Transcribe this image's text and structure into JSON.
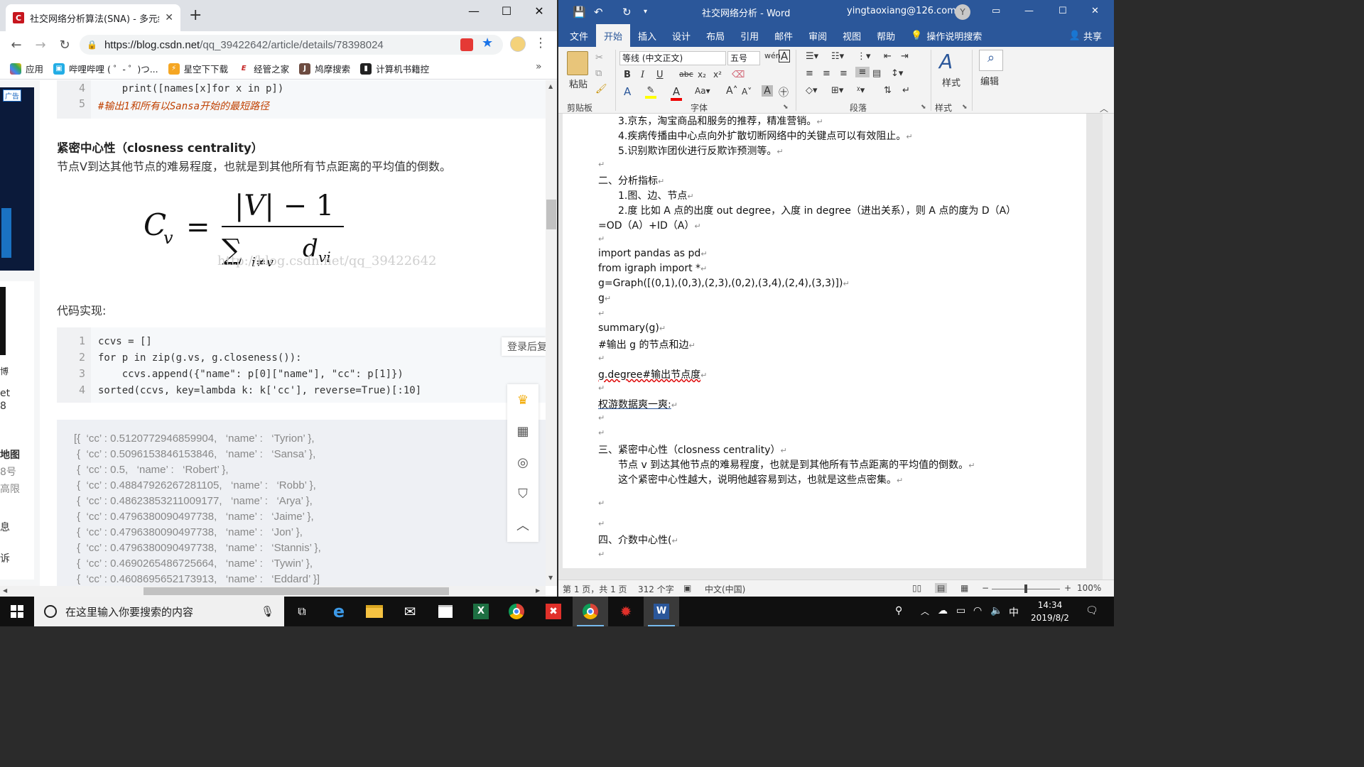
{
  "browser": {
    "tab_title": "社交网络分析算法(SNA) - 多元统",
    "url_host": "https://blog.csdn.net",
    "url_path": "/qq_39422642/article/details/78398024",
    "bookmarks": [
      {
        "label": "应用"
      },
      {
        "label": "哔哩哔哩 ( ゜- ゜)つ..."
      },
      {
        "label": "星空下下载"
      },
      {
        "label": "经管之家"
      },
      {
        "label": "鸠摩搜索"
      },
      {
        "label": "计算机书籍控"
      }
    ],
    "bookmarks_more": "»"
  },
  "article": {
    "top_code": {
      "lines": [
        {
          "num": "4",
          "text": "    print([names[x]for x in p])"
        },
        {
          "num": "5",
          "text": "#输出1和所有以Sansa开始的最短路径"
        }
      ]
    },
    "heading": "紧密中心性（closness centrality）",
    "description": "节点V到达其他节点的难易程度，也就是到其他所有节点距离的平均值的倒数。",
    "watermark": "http://blog.csdn.net/qq_39422642",
    "impl_label": "代码实现:",
    "code": {
      "lines": [
        {
          "num": "1",
          "text": "ccvs = []"
        },
        {
          "num": "2",
          "text": "for p in zip(g.vs, g.closeness()):"
        },
        {
          "num": "3",
          "text": "    ccvs.append({\"name\": p[0][\"name\"], \"cc\": p[1]})"
        },
        {
          "num": "4",
          "text": "sorted(ccvs, key=lambda k: k['cc'], reverse=True)[:10]"
        }
      ]
    },
    "output_rows": [
      "[{  ‘cc’ : 0.5120772946859904,   ‘name’ :   ‘Tyrion’ },",
      " {  ‘cc’ : 0.5096153846153846,   ‘name’ :   ‘Sansa’ },",
      " {  ‘cc’ : 0.5,   ‘name’ :   ‘Robert’ },",
      " {  ‘cc’ : 0.48847926267281105,   ‘name’ :   ‘Robb’ },",
      " {  ‘cc’ : 0.48623853211009177,   ‘name’ :   ‘Arya’ },",
      " {  ‘cc’ : 0.4796380090497738,   ‘name’ :   ‘Jaime’ },",
      " {  ‘cc’ : 0.4796380090497738,   ‘name’ :   ‘Jon’ },",
      " {  ‘cc’ : 0.4796380090497738,   ‘name’ :   ‘Stannis’ },",
      " {  ‘cc’ : 0.4690265486725664,   ‘name’ :   ‘Tywin’ },",
      " {  ‘cc’ : 0.4608695652173913,   ‘name’ :   ‘Eddard’ }]"
    ],
    "login_hint": "登录后复",
    "ad_tag": "广告",
    "left_card": [
      "博",
      "et",
      "8",
      "地图",
      "8号",
      "高限",
      "息",
      "诉"
    ]
  },
  "word": {
    "title": "社交网络分析  -  Word",
    "account": "yingtaoxiang@126.com",
    "avatar_letter": "Y",
    "tabs": [
      "文件",
      "开始",
      "插入",
      "设计",
      "布局",
      "引用",
      "邮件",
      "审阅",
      "视图",
      "帮助",
      "操作说明搜索"
    ],
    "share": "共享",
    "font_name": "等线 (中文正文)",
    "font_size": "五号",
    "groups": {
      "clipboard": "剪贴板",
      "font": "字体",
      "paragraph": "段落",
      "styles": "样式"
    },
    "paste_label": "粘贴",
    "styles_label": "样式",
    "edit_label": "编辑",
    "doc_lines": [
      "3.京东，淘宝商品和服务的推荐，精准营销。",
      "4.疾病传播由中心点向外扩散切断网络中的关键点可以有效阻止。",
      "5.识别欺诈团伙进行反欺诈预测等。",
      "二、分析指标",
      "1.图、边、节点",
      "2.度  比如 A 点的出度 out degree，入度 in degree（进出关系），则 A 点的度为 D（A）",
      "=OD（A）+ID（A）",
      "import pandas as pd",
      "from igraph import *",
      "g=Graph([(0,1),(0,3),(2,3),(0,2),(3,4),(2,4),(3,3)])",
      "g",
      "summary(g)",
      "#输出 g 的节点和边",
      "g.degree#输出节点度",
      "权游数据爽一爽:",
      "三、紧密中心性（closness centrality）",
      "节点 v 到达其他节点的难易程度，也就是到其他所有节点距离的平均值的倒数。",
      "这个紧密中心性越大，说明他越容易到达，也就是这些点密集。",
      "四、介数中心性("
    ],
    "status": {
      "page": "第 1 页，共 1 页",
      "words": "312 个字",
      "lang": "中文(中国)",
      "zoom": "100%"
    }
  },
  "taskbar": {
    "search_placeholder": "在这里输入你要搜索的内容",
    "time": "14:34",
    "date": "2019/8/2",
    "ime": "中"
  }
}
